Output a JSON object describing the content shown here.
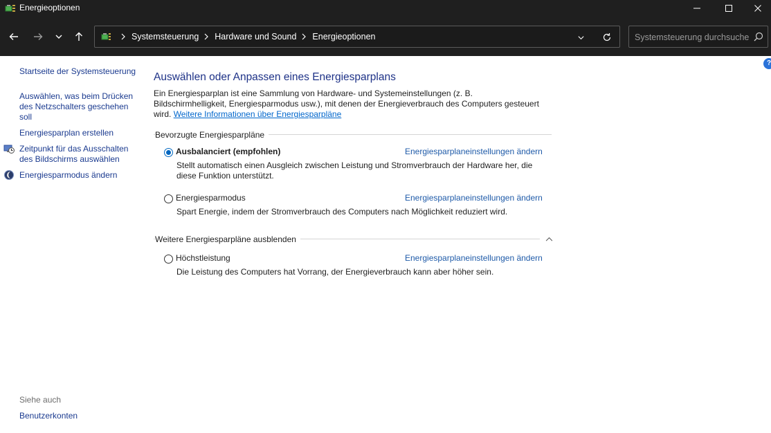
{
  "window": {
    "title": "Energieoptionen"
  },
  "address": {
    "crumbs": [
      "Systemsteuerung",
      "Hardware und Sound",
      "Energieoptionen"
    ]
  },
  "search": {
    "placeholder": "Systemsteuerung durchsuchen"
  },
  "sidebar": {
    "home": "Startseite der Systemsteuerung",
    "items": [
      {
        "label": "Auswählen, was beim Drücken des Netzschalters geschehen soll",
        "icon": "none"
      },
      {
        "label": "Energiesparplan erstellen",
        "icon": "none"
      },
      {
        "label": "Zeitpunkt für das Ausschalten des Bildschirms auswählen",
        "icon": "monitor-clock-icon"
      },
      {
        "label": "Energiesparmodus ändern",
        "icon": "moon-icon"
      }
    ],
    "see_also": "Siehe auch",
    "see_also_items": [
      "Benutzerkonten"
    ]
  },
  "main": {
    "heading": "Auswählen oder Anpassen eines Energiesparplans",
    "intro": "Ein Energiesparplan ist eine Sammlung von Hardware- und Systemeinstellungen (z. B. Bildschirmhelligkeit, Energiesparmodus usw.), mit denen der Energieverbrauch des Computers gesteuert wird.",
    "intro_link": "Weitere Informationen über Energiesparpläne",
    "preferred_label": "Bevorzugte Energiesparpläne",
    "more_label": "Weitere Energiesparpläne ausblenden",
    "change_link": "Energiesparplaneinstellungen ändern",
    "plans": [
      {
        "name": "Ausbalanciert (empfohlen)",
        "selected": true,
        "desc": "Stellt automatisch einen Ausgleich zwischen Leistung und Stromverbrauch der Hardware her, die diese Funktion unterstützt."
      },
      {
        "name": "Energiesparmodus",
        "selected": false,
        "desc": "Spart Energie, indem der Stromverbrauch des Computers nach Möglichkeit reduziert wird."
      },
      {
        "name": "Höchstleistung",
        "selected": false,
        "desc": "Die Leistung des Computers hat Vorrang, der Energieverbrauch kann aber höher sein."
      }
    ]
  },
  "help": {
    "label": "?"
  },
  "colors": {
    "titlebar": "#1f1f1f",
    "link": "#1a3a8f",
    "heading": "#1e3287",
    "accent": "#0067c0"
  }
}
